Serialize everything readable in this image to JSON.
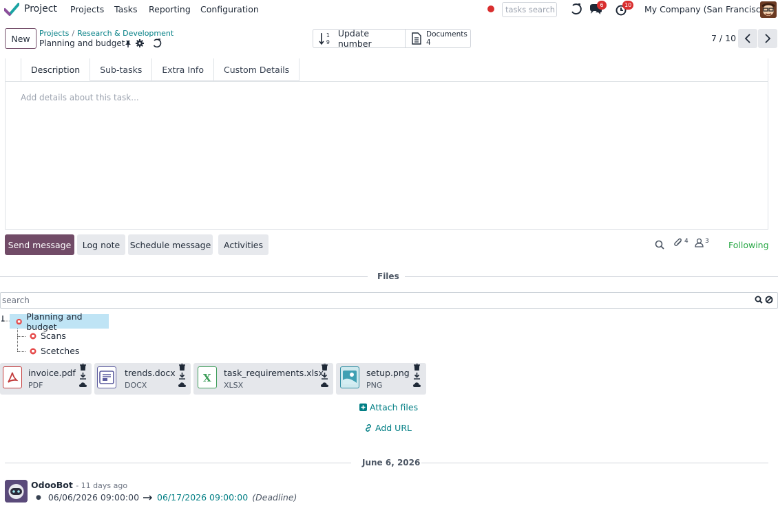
{
  "topnav": {
    "app_name": "Project",
    "menu": [
      "Projects",
      "Tasks",
      "Reporting",
      "Configuration"
    ],
    "search_placeholder": "tasks search",
    "messages_count": "6",
    "activities_count": "10",
    "company": "My Company (San Francisco)"
  },
  "control": {
    "new_label": "New",
    "breadcrumb": [
      "Projects",
      "Research & Development"
    ],
    "breadcrumb_sep": "/",
    "record_name": "Planning and budget",
    "update_label": "Update number",
    "documents_label": "Documents",
    "documents_count": "4",
    "pager": "7 / 10"
  },
  "notebook": {
    "tabs": [
      "Description",
      "Sub-tasks",
      "Extra Info",
      "Custom Details"
    ],
    "description_placeholder": "Add details about this task..."
  },
  "chatter": {
    "send_message": "Send message",
    "log_note": "Log note",
    "schedule_message": "Schedule message",
    "activities": "Activities",
    "attachments_count": "4",
    "followers_count": "3",
    "following": "Following"
  },
  "files": {
    "title": "Files",
    "search_placeholder": "search",
    "tree": {
      "root": "Planning and budget",
      "children": [
        "Scans",
        "Scetches"
      ]
    },
    "cards": [
      {
        "name": "invoice.pdf",
        "type": "PDF",
        "icon": "pdf-icon"
      },
      {
        "name": "trends.docx",
        "type": "DOCX",
        "icon": "docx-icon"
      },
      {
        "name": "task_requirements.xlsx",
        "type": "XLSX",
        "icon": "xlsx-icon"
      },
      {
        "name": "setup.png",
        "type": "PNG",
        "icon": "image-icon"
      }
    ],
    "attach_files": "Attach files",
    "add_url": "Add URL"
  },
  "messages": {
    "date_separator": "June 6, 2026",
    "items": [
      {
        "author": "OdooBot",
        "when": "- 11 days ago",
        "old_value": "06/06/2026 09:00:00",
        "new_value": "06/17/2026 09:00:00",
        "field": "(Deadline)"
      }
    ]
  },
  "colors": {
    "brand": "#714B67",
    "link": "#017e84",
    "following": "#28a745",
    "badge": "#d92e2e"
  }
}
